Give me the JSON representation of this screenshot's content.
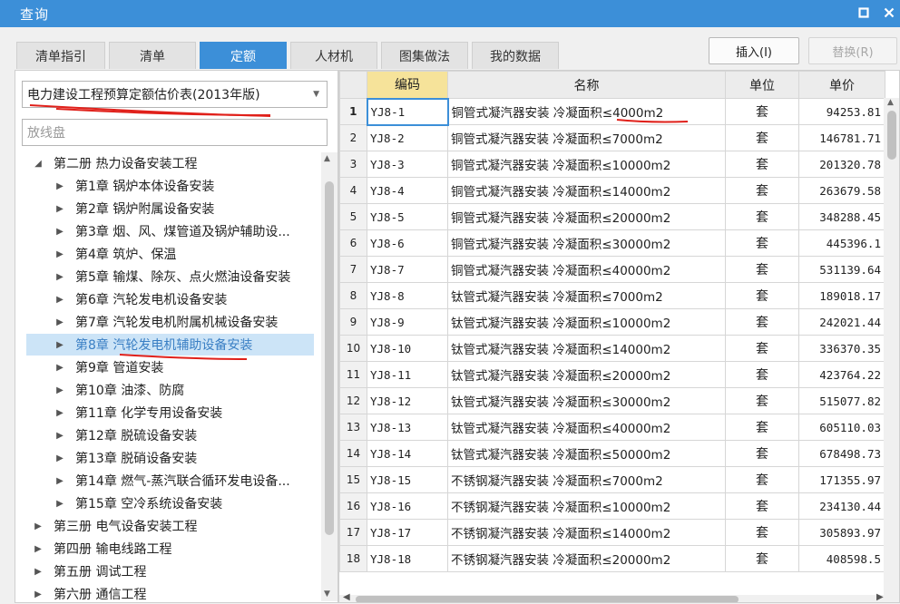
{
  "window": {
    "title": "查询",
    "maximize_icon": "maximize-icon",
    "close_icon": "close-icon"
  },
  "tabs": [
    {
      "label": "清单指引",
      "active": false
    },
    {
      "label": "清单",
      "active": false
    },
    {
      "label": "定额",
      "active": true
    },
    {
      "label": "人材机",
      "active": false
    },
    {
      "label": "图集做法",
      "active": false
    },
    {
      "label": "我的数据",
      "active": false
    }
  ],
  "actions": {
    "insert": "插入(I)",
    "replace": "替换(R)"
  },
  "left": {
    "library_select": "电力建设工程预算定额估价表(2013年版)",
    "search_placeholder": "放线盘",
    "tree": [
      {
        "level": 0,
        "expanded": true,
        "label": "第二册 热力设备安装工程"
      },
      {
        "level": 1,
        "label": "第1章 锅炉本体设备安装"
      },
      {
        "level": 1,
        "label": "第2章 锅炉附属设备安装"
      },
      {
        "level": 1,
        "label": "第3章 烟、风、煤管道及锅炉辅助设..."
      },
      {
        "level": 1,
        "label": "第4章 筑炉、保温"
      },
      {
        "level": 1,
        "label": "第5章 输煤、除灰、点火燃油设备安装"
      },
      {
        "level": 1,
        "label": "第6章 汽轮发电机设备安装"
      },
      {
        "level": 1,
        "label": "第7章 汽轮发电机附属机械设备安装"
      },
      {
        "level": 1,
        "label": "第8章 汽轮发电机辅助设备安装",
        "selected": true
      },
      {
        "level": 1,
        "label": "第9章 管道安装"
      },
      {
        "level": 1,
        "label": "第10章 油漆、防腐"
      },
      {
        "level": 1,
        "label": "第11章 化学专用设备安装"
      },
      {
        "level": 1,
        "label": "第12章 脱硫设备安装"
      },
      {
        "level": 1,
        "label": "第13章 脱硝设备安装"
      },
      {
        "level": 1,
        "label": "第14章 燃气-蒸汽联合循环发电设备..."
      },
      {
        "level": 1,
        "label": "第15章 空冷系统设备安装"
      },
      {
        "level": 0,
        "expanded": false,
        "label": "第三册 电气设备安装工程"
      },
      {
        "level": 0,
        "expanded": false,
        "label": "第四册 输电线路工程"
      },
      {
        "level": 0,
        "expanded": false,
        "label": "第五册 调试工程"
      },
      {
        "level": 0,
        "expanded": false,
        "label": "第六册 通信工程"
      }
    ]
  },
  "grid": {
    "columns": [
      "",
      "编码",
      "名称",
      "单位",
      "单价"
    ],
    "rows": [
      {
        "n": "1",
        "code": "YJ8-1",
        "name": "铜管式凝汽器安装 冷凝面积≤4000m2",
        "unit": "套",
        "price": "94253.81"
      },
      {
        "n": "2",
        "code": "YJ8-2",
        "name": "铜管式凝汽器安装 冷凝面积≤7000m2",
        "unit": "套",
        "price": "146781.71"
      },
      {
        "n": "3",
        "code": "YJ8-3",
        "name": "铜管式凝汽器安装 冷凝面积≤10000m2",
        "unit": "套",
        "price": "201320.78"
      },
      {
        "n": "4",
        "code": "YJ8-4",
        "name": "铜管式凝汽器安装 冷凝面积≤14000m2",
        "unit": "套",
        "price": "263679.58"
      },
      {
        "n": "5",
        "code": "YJ8-5",
        "name": "铜管式凝汽器安装 冷凝面积≤20000m2",
        "unit": "套",
        "price": "348288.45"
      },
      {
        "n": "6",
        "code": "YJ8-6",
        "name": "铜管式凝汽器安装 冷凝面积≤30000m2",
        "unit": "套",
        "price": "445396.1"
      },
      {
        "n": "7",
        "code": "YJ8-7",
        "name": "铜管式凝汽器安装 冷凝面积≤40000m2",
        "unit": "套",
        "price": "531139.64"
      },
      {
        "n": "8",
        "code": "YJ8-8",
        "name": "钛管式凝汽器安装 冷凝面积≤7000m2",
        "unit": "套",
        "price": "189018.17"
      },
      {
        "n": "9",
        "code": "YJ8-9",
        "name": "钛管式凝汽器安装 冷凝面积≤10000m2",
        "unit": "套",
        "price": "242021.44"
      },
      {
        "n": "10",
        "code": "YJ8-10",
        "name": "钛管式凝汽器安装 冷凝面积≤14000m2",
        "unit": "套",
        "price": "336370.35"
      },
      {
        "n": "11",
        "code": "YJ8-11",
        "name": "钛管式凝汽器安装 冷凝面积≤20000m2",
        "unit": "套",
        "price": "423764.22"
      },
      {
        "n": "12",
        "code": "YJ8-12",
        "name": "钛管式凝汽器安装 冷凝面积≤30000m2",
        "unit": "套",
        "price": "515077.82"
      },
      {
        "n": "13",
        "code": "YJ8-13",
        "name": "钛管式凝汽器安装 冷凝面积≤40000m2",
        "unit": "套",
        "price": "605110.03"
      },
      {
        "n": "14",
        "code": "YJ8-14",
        "name": "钛管式凝汽器安装 冷凝面积≤50000m2",
        "unit": "套",
        "price": "678498.73"
      },
      {
        "n": "15",
        "code": "YJ8-15",
        "name": "不锈钢凝汽器安装 冷凝面积≤7000m2",
        "unit": "套",
        "price": "171355.97"
      },
      {
        "n": "16",
        "code": "YJ8-16",
        "name": "不锈钢凝汽器安装 冷凝面积≤10000m2",
        "unit": "套",
        "price": "234130.44"
      },
      {
        "n": "17",
        "code": "YJ8-17",
        "name": "不锈钢凝汽器安装 冷凝面积≤14000m2",
        "unit": "套",
        "price": "305893.97"
      },
      {
        "n": "18",
        "code": "YJ8-18",
        "name": "不锈钢凝汽器安装 冷凝面积≤20000m2",
        "unit": "套",
        "price": "408598.5"
      }
    ]
  },
  "colors": {
    "title_bar": "#3c8fd8",
    "active_tab": "#3c8fd8",
    "code_header": "#f6e39a",
    "selected_tree": "#cce4f7",
    "annotation": "#e0201a"
  }
}
